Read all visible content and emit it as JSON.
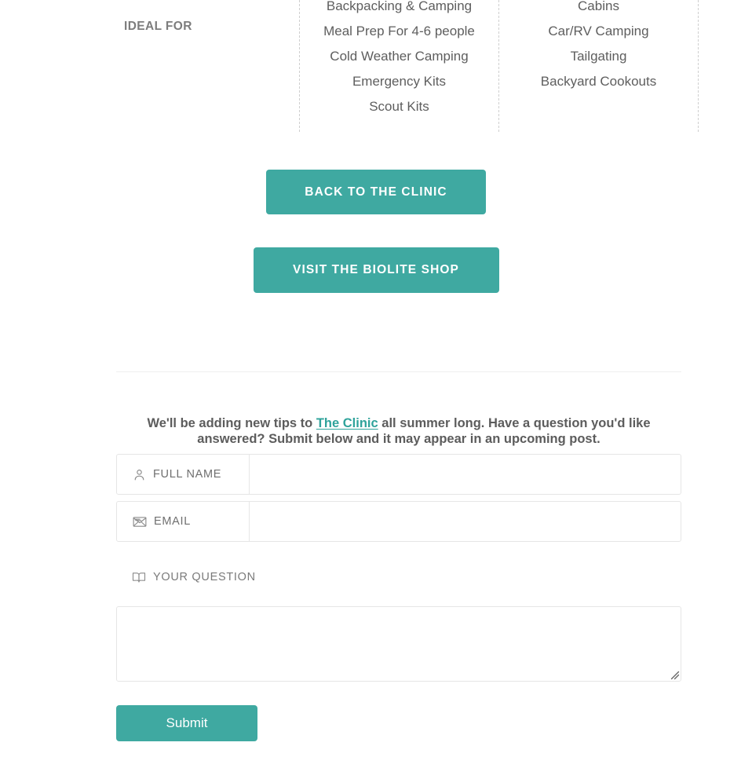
{
  "spec_table": {
    "row_label": "IDEAL FOR",
    "columns": [
      {
        "name": "column-1",
        "items": [
          "Backpacking & Camping",
          "Meal Prep For 4-6 people",
          "Cold Weather Camping",
          "Emergency Kits",
          "Scout Kits"
        ]
      },
      {
        "name": "column-2",
        "items": [
          "Cabins",
          "Car/RV Camping",
          "Tailgating",
          "Backyard Cookouts"
        ]
      }
    ]
  },
  "cta": {
    "back_to_clinic": "BACK TO THE CLINIC",
    "visit_shop": "VISIT THE BIOLITE SHOP"
  },
  "intro": {
    "before_link": "We'll be adding new tips to ",
    "link_text": "The Clinic",
    "after_link": " all summer long. Have a question you'd like answered? Submit below and it may appear in an upcoming post."
  },
  "form": {
    "full_name": {
      "label": "FULL NAME",
      "icon": "user-icon",
      "value": "",
      "placeholder": ""
    },
    "email": {
      "label": "EMAIL",
      "icon": "envelope-icon",
      "value": "",
      "placeholder": ""
    },
    "question": {
      "label": "YOUR QUESTION",
      "icon": "open-book-icon",
      "value": "",
      "placeholder": ""
    },
    "submit_label": "Submit"
  },
  "colors": {
    "accent_teal": "#3fa9a1",
    "link_teal": "#2fa39b",
    "text_gray": "#5a5a5a",
    "border_gray": "#e6e6e6",
    "dashed_gray": "#cfcfcf"
  }
}
